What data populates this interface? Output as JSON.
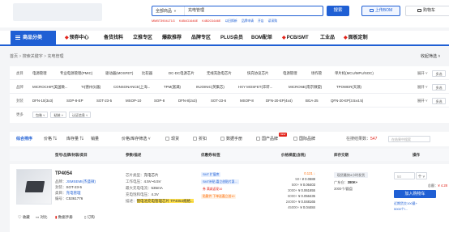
{
  "header": {
    "search": {
      "category": "全部商品",
      "query": "充电管理",
      "button": "搜索"
    },
    "hot_keywords": [
      "MMBT3904LT1G",
      "K4B4G1646E",
      "K4B2G1646E",
      "以旧换新",
      "品牌申请",
      "开店",
      "读采购"
    ],
    "upload_bom": "上传BOM",
    "cart": "购物车"
  },
  "nav": {
    "category_label": "商品分类",
    "items": [
      "领券中心",
      "备货找料",
      "立推专区",
      "爆款推荐",
      "品牌专区",
      "PLUS会员",
      "BOM配单",
      "PCB/SMT",
      "工业品",
      "面板定制"
    ]
  },
  "breadcrumb": [
    "首页",
    "搜索关键字",
    "充电管理"
  ],
  "collapse_label": "收起筛选",
  "filters": [
    {
      "label": "类目",
      "options": [
        "电源管理",
        "专业电源管理(PMIC)",
        "驱动器(MOSFET)",
        "比较器",
        "DC-DC电源芯片",
        "无线充放电芯片",
        "快充协议芯片",
        "电源管理",
        "场作管",
        "单片机(MCU/MPU/SOC)"
      ]
    },
    {
      "label": "品牌",
      "options": [
        "MICROCHIP(美国微...",
        "TI(德州仪器)",
        "CONSONANCE(上海...",
        "TPM(富满)",
        "INJOINIC(英集芯)",
        "HXY MOSFET(华轩...",
        "MICRONE(南京微盟)",
        "TPOWER(天源)"
      ]
    },
    {
      "label": "封装",
      "options": [
        "DFN-10(3x3)",
        "SOP-8-EP",
        "SOT-23-5",
        "MSOP-10",
        "SOP-8",
        "DFN-8(2x3)",
        "SOT-23-6",
        "MSOP-8",
        "DFN-20-EP(4x4)",
        "BGA-25",
        "QFN-20-EP(3.5x4.5)"
      ]
    },
    {
      "label": "更多",
      "options": [
        "包装",
        "粘装",
        "认证信息"
      ]
    }
  ],
  "filter_more": "展开",
  "filter_multi": "多选",
  "sortbar": {
    "items": [
      "综合排序",
      "价格",
      "库存量",
      "销量"
    ],
    "price_inventory": "价格/库存筛选",
    "checks": [
      "现货",
      "折扣",
      "数据手册",
      "国产品牌",
      "国际品牌"
    ],
    "new_badge": "NEW",
    "count_prefix": "在搜结果数：",
    "count": "547",
    "result_search_placeholder": "在结果中搜索"
  },
  "table_headers": [
    "型号/品牌/封装/类目",
    "参数/描述",
    "优惠券/标签",
    "价格梯度(含税)",
    "库存交期",
    "操作"
  ],
  "product": {
    "model": "TP4054",
    "brand_label": "品牌：",
    "brand": "JSMSEMI(杰盛微)",
    "package_label": "封装：",
    "package": "SOT-23-5",
    "category_label": "类目：",
    "category": "充电管理",
    "code_label": "编号：",
    "code": "C5361776",
    "actions": [
      "收藏",
      "对比",
      "数据手册",
      "订购"
    ],
    "params": [
      {
        "label": "芯片类型：",
        "value": "充电芯片"
      },
      {
        "label": "工作电压：",
        "value": "4.5V~6.5V"
      },
      {
        "label": "最大充电电流：",
        "value": "535mA"
      },
      {
        "label": "充电饱和电压：",
        "value": "4.2V"
      },
      {
        "label": "描述：",
        "value": "锂电池充电管理芯片 TP4054规格..."
      }
    ],
    "promos": [
      {
        "text": "SMT 扩展库",
        "style": "blue"
      },
      {
        "text": "SMT补贴 嘉立创贴片惠...",
        "style": "blue"
      },
      {
        "text": "券 满减返现10",
        "style": "red"
      },
      {
        "text": "贴敷件 下单送嘉立创10",
        "style": "orange"
      }
    ],
    "prices": [
      {
        "qty": "",
        "price": "0.121 ↓",
        "promo": true
      },
      {
        "qty": "50+",
        "price": "¥ 0.0688"
      },
      {
        "qty": "500+",
        "price": "¥ 0.06403"
      },
      {
        "qty": "3000+",
        "price": "¥ 0.061655"
      },
      {
        "qty": "6000+",
        "price": "¥ 0.056435"
      },
      {
        "qty": "24000+",
        "price": "¥ 0.048165"
      },
      {
        "qty": "45000+",
        "price": "¥ 0.04484"
      }
    ],
    "stock": {
      "box": "现货最快4小时发货",
      "lines": [
        {
          "label": "广东仓：",
          "value": "380K+"
        },
        {
          "label": "",
          "value": "3000个/圆盘"
        }
      ]
    },
    "order": {
      "qty_placeholder": "50",
      "unit": "个",
      "total_label": "总额：",
      "total": "¥ 4.28",
      "add_cart": "加入购物车",
      "notes": [
        "近期货交100量+",
        "5000个/..."
      ]
    }
  }
}
